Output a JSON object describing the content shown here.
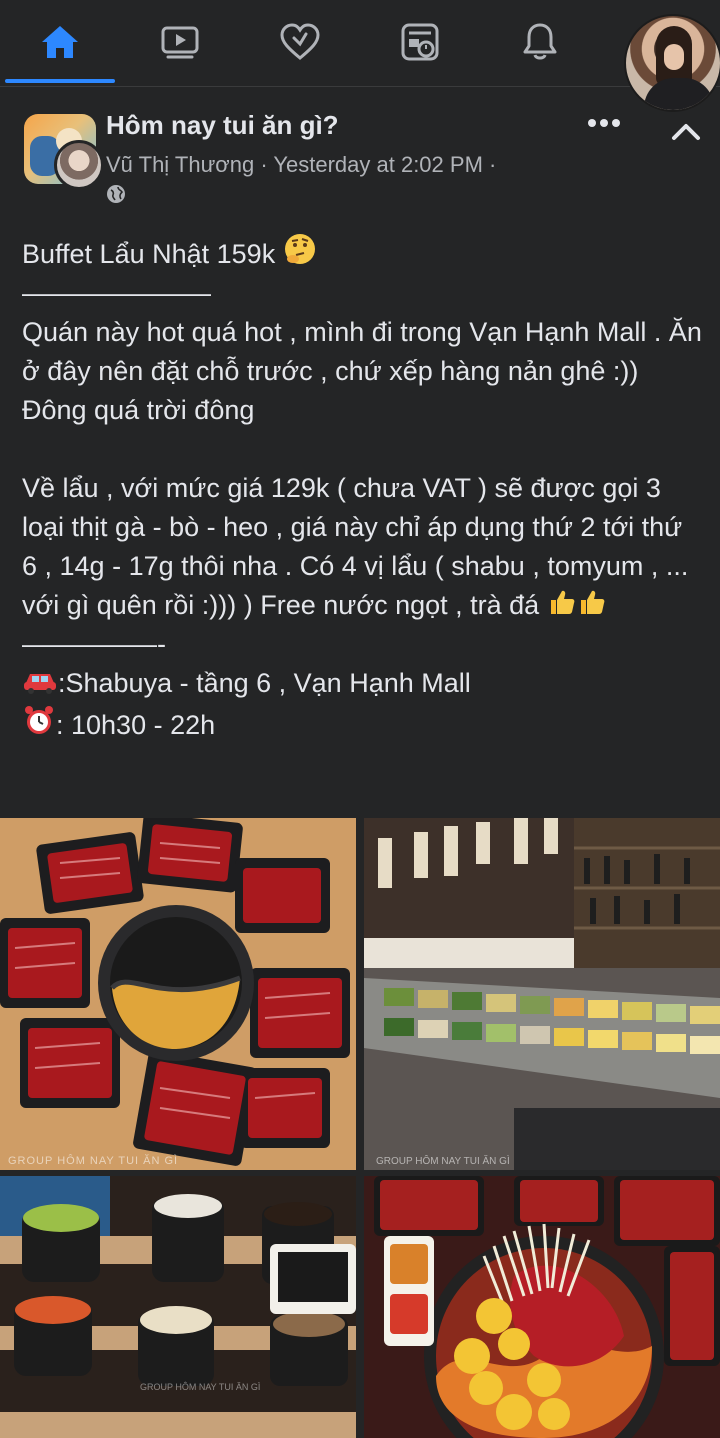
{
  "nav": {
    "items": [
      {
        "name": "home",
        "icon": "home-icon",
        "active": true
      },
      {
        "name": "watch",
        "icon": "video-icon",
        "active": false
      },
      {
        "name": "dating",
        "icon": "heart-icon",
        "active": false
      },
      {
        "name": "news",
        "icon": "newsfeed-icon",
        "active": false
      },
      {
        "name": "notifications",
        "icon": "bell-icon",
        "active": false
      }
    ],
    "accent_color": "#2d88ff"
  },
  "post": {
    "group_name": "Hôm nay tui ăn gì?",
    "author": "Vũ Thị Thương",
    "time_line": " · Yesterday at 2:02 PM ·",
    "privacy_icon": "globe-icon",
    "lines": {
      "title": "Buffet Lẩu Nhật 159k",
      "sep1": "———————",
      "p1": "Quán này hot quá hot , mình đi trong Vạn Hạnh Mall . Ăn ở đây nên đặt chỗ trước , chứ xếp hàng nản ghê :)) Đông quá trời đông",
      "p2": "Về lẩu , với mức giá 129k ( chưa VAT ) sẽ được gọi 3 loại thịt gà - bò - heo , giá này chỉ áp dụng thứ 2 tới thứ 6 , 14g - 17g thôi nha . Có 4 vị lẩu ( shabu , tomyum , ... với gì quên rồi :))) ) Free nước ngọt , trà đá",
      "sep2": "—————-",
      "address": ":Shabuya - tầng 6 , Vạn Hạnh Mall",
      "hours": ": 10h30 - 22h"
    }
  },
  "photos": [
    {
      "name": "hotpot-meat-trays"
    },
    {
      "name": "buffet-counter"
    },
    {
      "name": "sauce-pots",
      "watermark": "GROUP HÔM NAY TUI ĂN GÌ"
    },
    {
      "name": "hotpot-mushrooms-corn"
    }
  ],
  "watermarks": {
    "p1": "GROUP HÔM NAY TUI ĂN GÌ",
    "p2": "GROUP HÔM NAY TUI ĂN GÌ",
    "p3": "GROUP HÔM NAY TUI ĂN GÌ"
  }
}
